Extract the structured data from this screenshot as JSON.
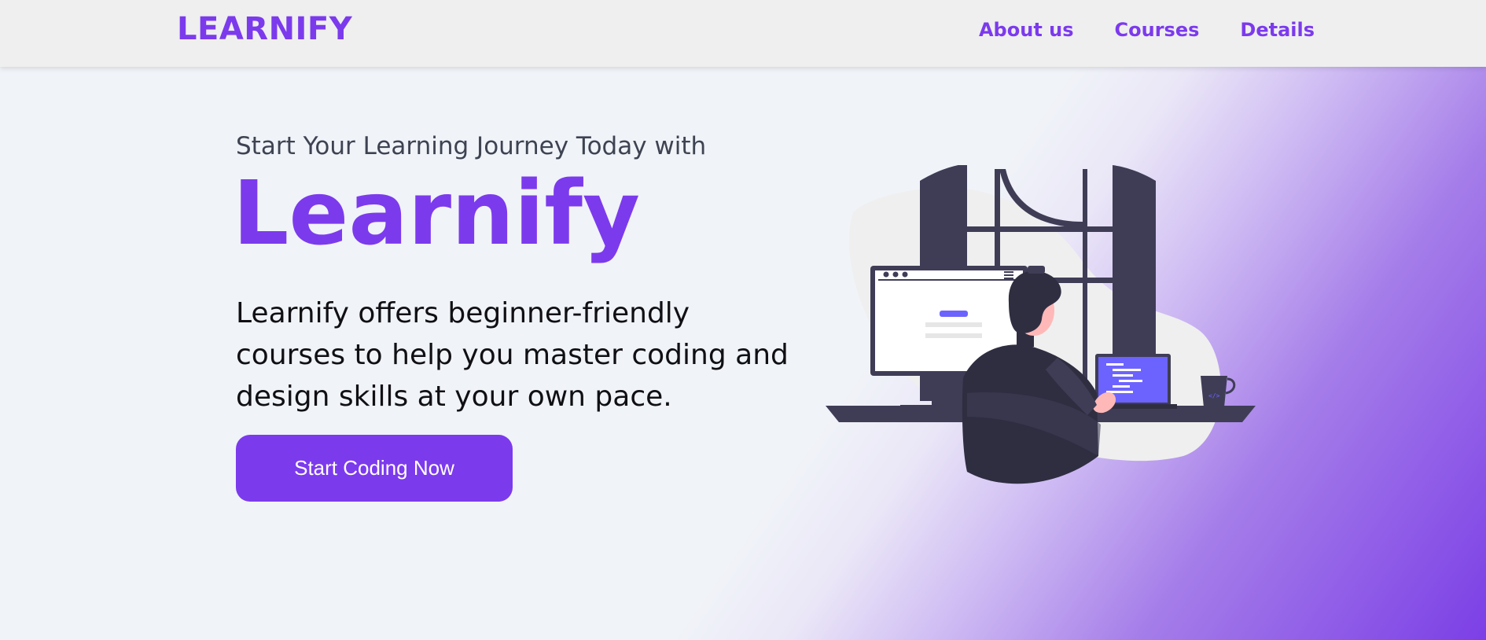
{
  "navbar": {
    "logo": "LEARNIFY",
    "links": [
      "About us",
      "Courses",
      "Details"
    ]
  },
  "hero": {
    "tagline": "Start Your Learning Journey Today with",
    "title": "Learnify",
    "description": "Learnify offers beginner-friendly courses to help you master coding and design skills at your own pace.",
    "cta_label": "Start Coding Now"
  },
  "colors": {
    "accent": "#7c3aed",
    "navbar_bg": "#efefef",
    "page_bg": "#f0f3f8",
    "illustration_dark": "#3f3d56",
    "illustration_screen": "#6c63ff"
  },
  "illustration": {
    "icon": "person-coding-at-desk-illustration"
  }
}
